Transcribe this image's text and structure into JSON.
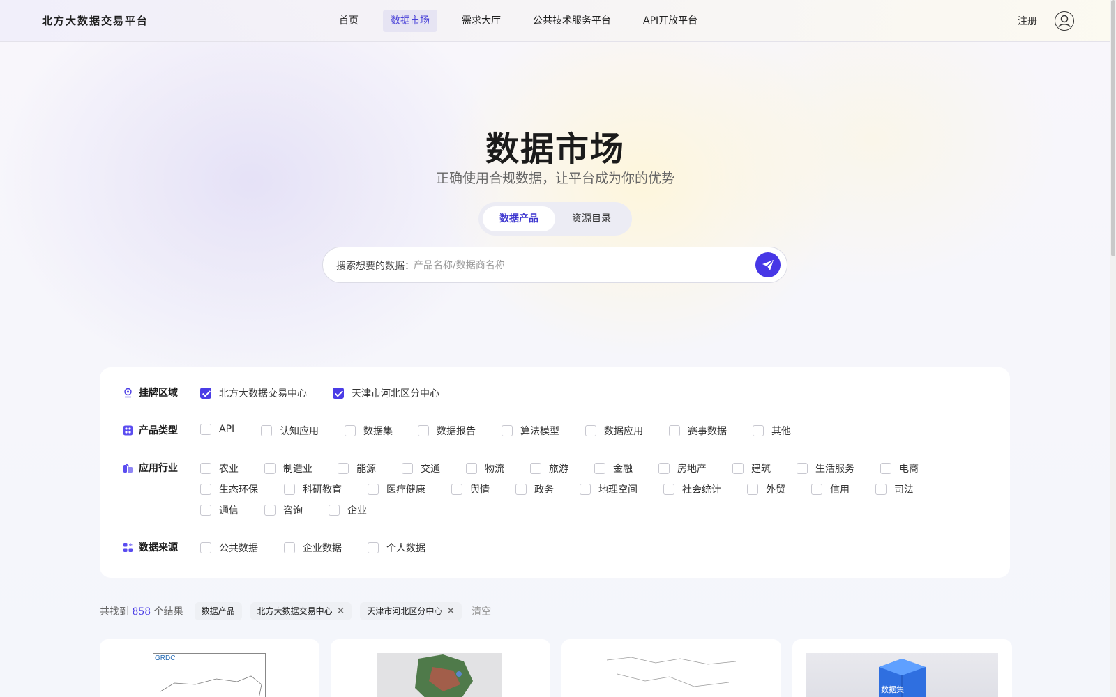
{
  "header": {
    "logo": "北方大数据交易平台",
    "nav": [
      "首页",
      "数据市场",
      "需求大厅",
      "公共技术服务平台",
      "API开放平台"
    ],
    "active_nav": "数据市场",
    "register": "注册"
  },
  "hero": {
    "title": "数据市场",
    "subtitle": "正确使用合规数据，让平台成为你的优势",
    "tabs": [
      "数据产品",
      "资源目录"
    ],
    "active_tab": "数据产品",
    "search_label": "搜索想要的数据：",
    "search_placeholder": "产品名称/数据商名称",
    "search_value": ""
  },
  "filters": {
    "region": {
      "label": "挂牌区域",
      "options": [
        {
          "label": "北方大数据交易中心",
          "checked": true
        },
        {
          "label": "天津市河北区分中心",
          "checked": true
        }
      ]
    },
    "product_type": {
      "label": "产品类型",
      "options": [
        "API",
        "认知应用",
        "数据集",
        "数据报告",
        "算法模型",
        "数据应用",
        "赛事数据",
        "其他"
      ]
    },
    "industry": {
      "label": "应用行业",
      "rows": [
        [
          "农业",
          "制造业",
          "能源",
          "交通",
          "物流",
          "旅游",
          "金融",
          "房地产",
          "建筑",
          "生活服务",
          "电商"
        ],
        [
          "生态环保",
          "科研教育",
          "医疗健康",
          "舆情",
          "政务",
          "地理空间",
          "社会统计",
          "外贸",
          "信用",
          "司法"
        ],
        [
          "通信",
          "咨询",
          "企业"
        ]
      ]
    },
    "source": {
      "label": "数据来源",
      "options": [
        "公共数据",
        "企业数据",
        "个人数据"
      ]
    }
  },
  "results": {
    "prefix": "共找到",
    "count": "858",
    "suffix": "个结果",
    "chips": [
      {
        "label": "数据产品",
        "removable": false
      },
      {
        "label": "北方大数据交易中心",
        "removable": true
      },
      {
        "label": "天津市河北区分中心",
        "removable": true
      }
    ],
    "clear": "清空"
  },
  "cards": [
    {
      "thumb_text": "GRDC"
    },
    {
      "thumb_text": ""
    },
    {
      "thumb_text": ""
    },
    {
      "thumb_text": "数据集"
    }
  ],
  "colors": {
    "accent": "#4a3ce6",
    "active_nav_bg": "#e6e4f3"
  }
}
